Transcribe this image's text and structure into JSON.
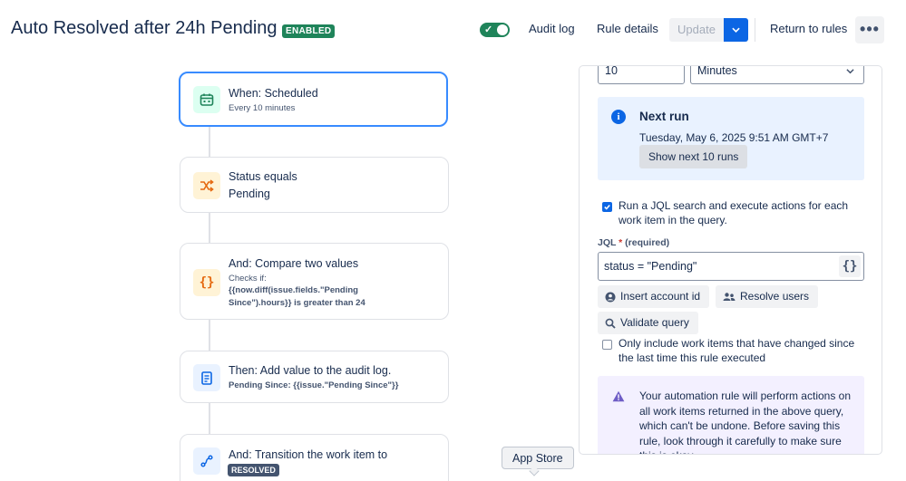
{
  "header": {
    "title": "Auto Resolved after 24h Pending",
    "status_badge": "ENABLED",
    "audit_log": "Audit log",
    "rule_details": "Rule details",
    "update": "Update",
    "return_to_rules": "Return to rules",
    "more": "•••"
  },
  "colors": {
    "accent": "#0c66e4",
    "enabled": "#1f845a",
    "selected_border": "#388bff"
  },
  "nodes": [
    {
      "icon": "calendar-icon",
      "title": "When: Scheduled",
      "subtitle": "Every 10 minutes"
    },
    {
      "icon": "shuffle-icon",
      "title": "Status equals",
      "line2": "Pending"
    },
    {
      "icon": "braces-icon",
      "title": "And: Compare two values",
      "subtitle": "Checks if:",
      "detail_line1": "{{now.diff(issue.fields.\"Pending",
      "detail_line2": "Since\").hours}} is greater than 24"
    },
    {
      "icon": "document-icon",
      "title": "Then: Add value to the audit log.",
      "subtitle": "Pending Since: {{issue.\"Pending Since\"}}"
    },
    {
      "icon": "transition-icon",
      "title": "And: Transition the work item to",
      "badge": "RESOLVED"
    }
  ],
  "panel": {
    "interval_value": "10",
    "interval_unit": "Minutes",
    "next_run": {
      "title": "Next run",
      "date": "Tuesday, May 6, 2025 9:51 AM GMT+7",
      "show_next": "Show next 10 runs"
    },
    "jql_checkbox": {
      "checked": true,
      "label": "Run a JQL search and execute actions for each work item in the query."
    },
    "jql": {
      "label": "JQL",
      "required_mark": "*",
      "required_text": "(required)",
      "value": "status = \"Pending\"",
      "braces": "{}"
    },
    "insert_account_id": "Insert account id",
    "resolve_users": "Resolve users",
    "validate_query": "Validate query",
    "changed_checkbox": {
      "checked": false,
      "label": "Only include work items that have changed since the last time this rule executed"
    },
    "warning": "Your automation rule will perform actions on all work items returned in the above query, which can't be undone. Before saving this rule, look through it carefully to make sure this is okay."
  },
  "tooltip": "App Store"
}
